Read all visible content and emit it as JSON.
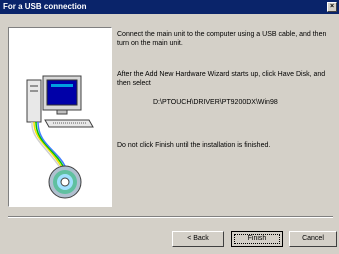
{
  "window": {
    "title": "For a USB connection",
    "close_glyph": "×"
  },
  "instructions": {
    "step1": "Connect the main unit to the computer using a USB cable, and then turn on the main unit.",
    "step2": "After the Add New Hardware Wizard starts up, click Have Disk, and then select",
    "driver_path": "D:\\PTOUCH\\DRIVER\\PT9200DX\\Win98",
    "step3": "Do not click Finish until the installation is finished."
  },
  "buttons": {
    "back": "< Back",
    "finish": "Finish",
    "cancel": "Cancel"
  },
  "illustration": {
    "icons": [
      "computer-icon",
      "usb-cable-icon",
      "cd-rom-icon"
    ],
    "colors": {
      "screen": "#0000a8",
      "cable_yellow": "#f0e000",
      "cable_green": "#00c000",
      "cable_blue": "#4080ff"
    }
  }
}
